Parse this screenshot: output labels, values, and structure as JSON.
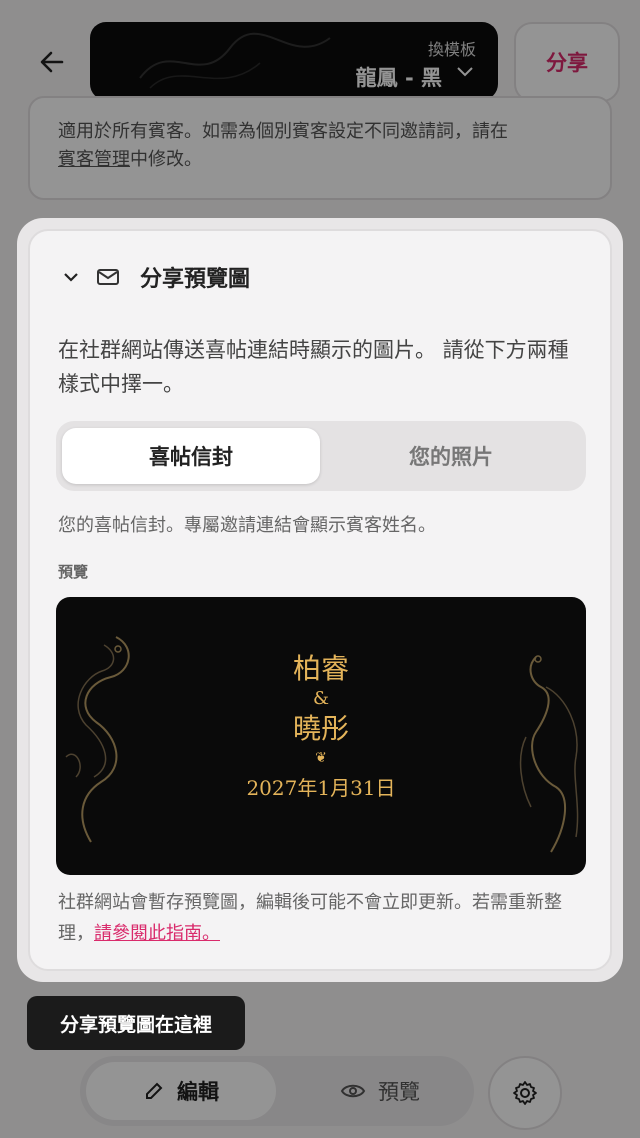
{
  "header": {
    "template_sub": "換模板",
    "template_name": "龍鳳 - 黑",
    "share_label": "分享"
  },
  "behind_card": {
    "line1": "適用於所有賓客。如需為個別賓客設定不同邀請詞，請在",
    "link": "賓客管理",
    "line2_rest": "中修改。"
  },
  "card": {
    "title": "分享預覽圖",
    "description": "在社群網站傳送喜帖連結時顯示的圖片。 請從下方兩種樣式中擇一。",
    "toggle": {
      "option_a": "喜帖信封",
      "option_b": "您的照片"
    },
    "option_desc": "您的喜帖信封。專屬邀請連結會顯示賓客姓名。",
    "preview_label": "預覽",
    "preview": {
      "name1": "柏睿",
      "amp": "&",
      "name2": "曉彤",
      "ornament": "❦",
      "date": "2027年1月31日"
    },
    "note": "社群網站會暫存預覽圖，編輯後可能不會立即更新。若需重新整理，",
    "note_link": "請參閱此指南。"
  },
  "tooltip": "分享預覽圖在這裡",
  "bottom_nav": {
    "edit": "編輯",
    "preview": "預覽"
  },
  "colors": {
    "accent": "#d92a6b",
    "gold": "#e4b45a",
    "dark": "#0a0a0a"
  }
}
